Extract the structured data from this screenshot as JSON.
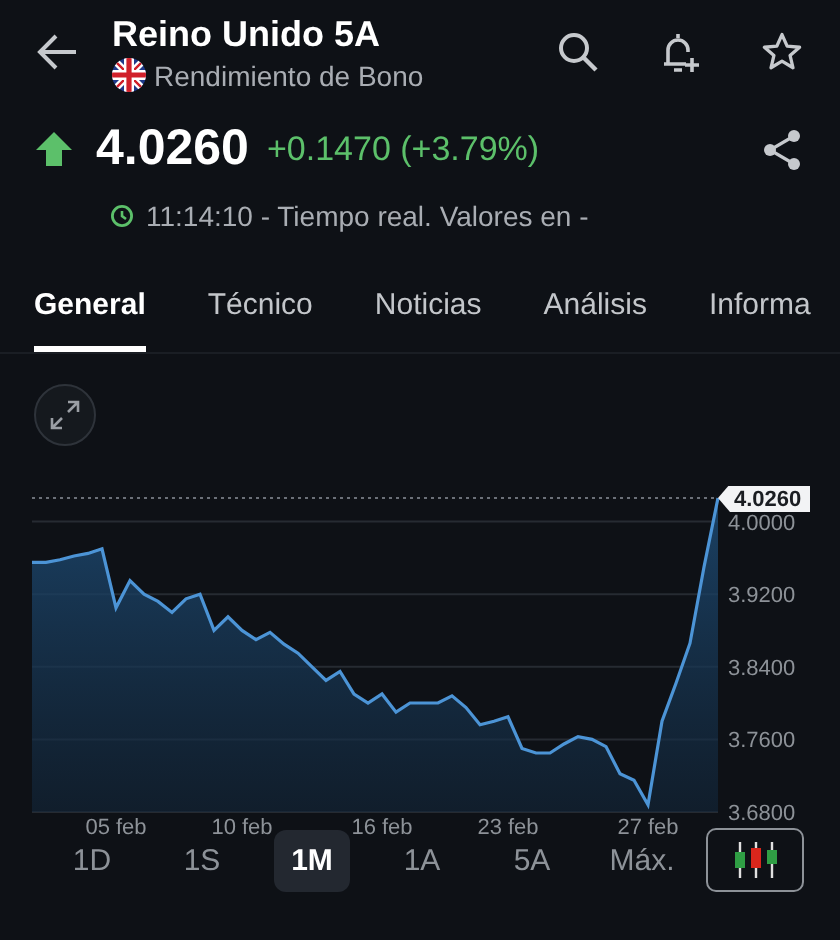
{
  "header": {
    "title": "Reino Unido 5A",
    "subtitle": "Rendimiento de Bono"
  },
  "quote": {
    "positive": true,
    "price": "4.0260",
    "change": "+0.1470 (+3.79%)",
    "time_status": "11:14:10 - Tiempo real. Valores en -"
  },
  "tabs": [
    {
      "label": "General",
      "selected": true
    },
    {
      "label": "Técnico",
      "selected": false
    },
    {
      "label": "Noticias",
      "selected": false
    },
    {
      "label": "Análisis",
      "selected": false
    },
    {
      "label": "Informa",
      "selected": false
    }
  ],
  "chart": {
    "chart_data": {
      "type": "area",
      "grid": true,
      "categories": [
        null,
        null,
        null,
        null,
        null,
        null,
        "05 feb",
        null,
        null,
        null,
        null,
        null,
        null,
        null,
        null,
        "10 feb",
        null,
        null,
        null,
        null,
        null,
        null,
        null,
        null,
        null,
        "16 feb",
        null,
        null,
        null,
        null,
        null,
        null,
        null,
        null,
        "23 feb",
        null,
        null,
        null,
        null,
        null,
        null,
        null,
        null,
        null,
        "27 feb",
        null,
        null,
        null,
        null,
        null
      ],
      "ylim": [
        3.68,
        4.026
      ],
      "values": [
        3.955,
        3.955,
        3.958,
        3.962,
        3.965,
        3.97,
        3.905,
        3.935,
        3.92,
        3.912,
        3.9,
        3.915,
        3.92,
        3.88,
        3.895,
        3.88,
        3.87,
        3.878,
        3.865,
        3.855,
        3.84,
        3.825,
        3.835,
        3.81,
        3.8,
        3.81,
        3.79,
        3.8,
        3.8,
        3.8,
        3.808,
        3.795,
        3.776,
        3.78,
        3.785,
        3.75,
        3.745,
        3.745,
        3.755,
        3.763,
        3.76,
        3.752,
        3.722,
        3.715,
        3.688,
        3.78,
        3.822,
        3.866,
        3.95,
        4.026
      ],
      "yticks": [
        {
          "value": 4.0,
          "label": "4.0000"
        },
        {
          "value": 3.92,
          "label": "3.9200"
        },
        {
          "value": 3.84,
          "label": "3.8400"
        },
        {
          "value": 3.76,
          "label": "3.7600"
        },
        {
          "value": 3.68,
          "label": "3.6800"
        }
      ],
      "ref_lines": [
        {
          "label": "4.0260"
        }
      ]
    }
  },
  "ranges": [
    {
      "label": "1D",
      "selected": false
    },
    {
      "label": "1S",
      "selected": false
    },
    {
      "label": "1M",
      "selected": true
    },
    {
      "label": "1A",
      "selected": false
    },
    {
      "label": "5A",
      "selected": false
    },
    {
      "label": "Máx.",
      "selected": false
    }
  ]
}
